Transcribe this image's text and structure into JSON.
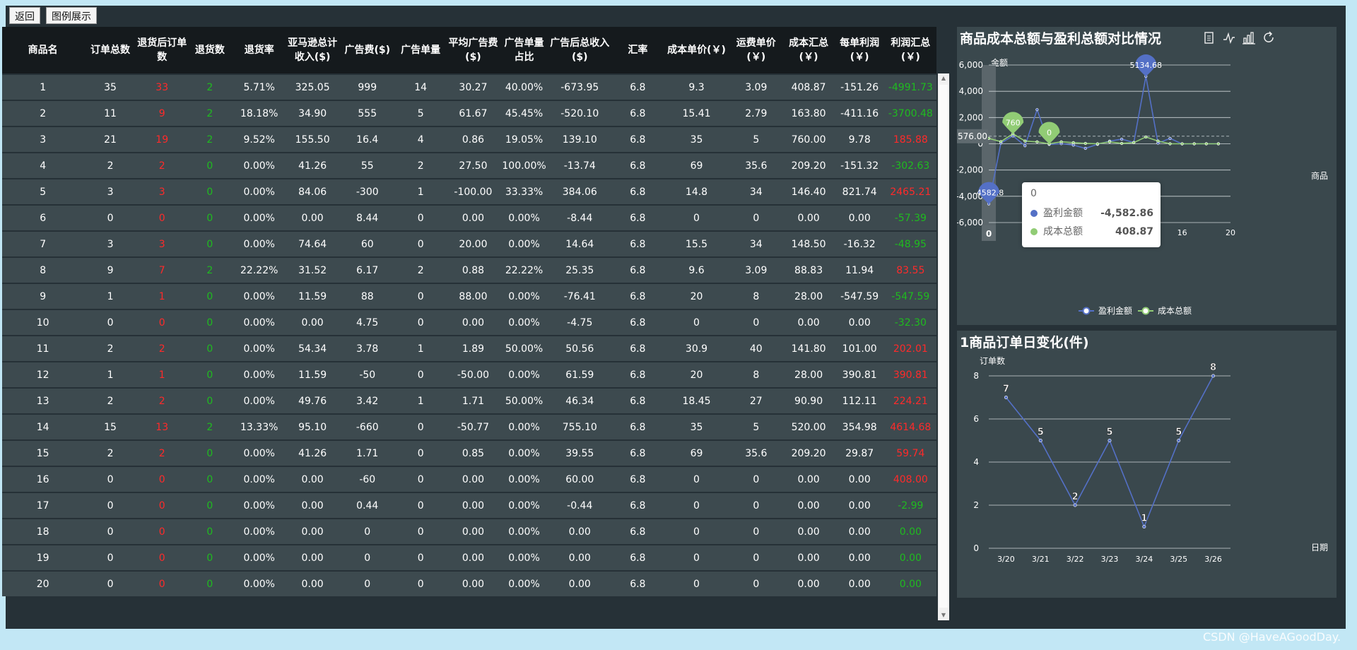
{
  "toolbar": {
    "back_label": "返回",
    "legend_label": "图例展示"
  },
  "table": {
    "headers": [
      "商品名",
      "订单总数",
      "退货后订单数",
      "退货数",
      "退货率",
      "亚马逊总计收入($)",
      "广告费($)",
      "广告单量",
      "平均广告费($)",
      "广告单量占比",
      "广告后总收入($)",
      "汇率",
      "成本单价(￥)",
      "运费单价(￥)",
      "成本汇总(￥)",
      "每单利润(￥)",
      "利润汇总(￥)"
    ],
    "rows": [
      [
        "1",
        "35",
        "33",
        "2",
        "5.71%",
        "325.05",
        "999",
        "14",
        "30.27",
        "40.00%",
        "-673.95",
        "6.8",
        "9.3",
        "3.09",
        "408.87",
        "-151.26",
        "-4991.73"
      ],
      [
        "2",
        "11",
        "9",
        "2",
        "18.18%",
        "34.90",
        "555",
        "5",
        "61.67",
        "45.45%",
        "-520.10",
        "6.8",
        "15.41",
        "2.79",
        "163.80",
        "-411.16",
        "-3700.48"
      ],
      [
        "3",
        "21",
        "19",
        "2",
        "9.52%",
        "155.50",
        "16.4",
        "4",
        "0.86",
        "19.05%",
        "139.10",
        "6.8",
        "35",
        "5",
        "760.00",
        "9.78",
        "185.88"
      ],
      [
        "4",
        "2",
        "2",
        "0",
        "0.00%",
        "41.26",
        "55",
        "2",
        "27.50",
        "100.00%",
        "-13.74",
        "6.8",
        "69",
        "35.6",
        "209.20",
        "-151.32",
        "-302.63"
      ],
      [
        "5",
        "3",
        "3",
        "0",
        "0.00%",
        "84.06",
        "-300",
        "1",
        "-100.00",
        "33.33%",
        "384.06",
        "6.8",
        "14.8",
        "34",
        "146.40",
        "821.74",
        "2465.21"
      ],
      [
        "6",
        "0",
        "0",
        "0",
        "0.00%",
        "0.00",
        "8.44",
        "0",
        "0.00",
        "0.00%",
        "-8.44",
        "6.8",
        "0",
        "0",
        "0.00",
        "0.00",
        "-57.39"
      ],
      [
        "7",
        "3",
        "3",
        "0",
        "0.00%",
        "74.64",
        "60",
        "0",
        "20.00",
        "0.00%",
        "14.64",
        "6.8",
        "15.5",
        "34",
        "148.50",
        "-16.32",
        "-48.95"
      ],
      [
        "8",
        "9",
        "7",
        "2",
        "22.22%",
        "31.52",
        "6.17",
        "2",
        "0.88",
        "22.22%",
        "25.35",
        "6.8",
        "9.6",
        "3.09",
        "88.83",
        "11.94",
        "83.55"
      ],
      [
        "9",
        "1",
        "1",
        "0",
        "0.00%",
        "11.59",
        "88",
        "0",
        "88.00",
        "0.00%",
        "-76.41",
        "6.8",
        "20",
        "8",
        "28.00",
        "-547.59",
        "-547.59"
      ],
      [
        "10",
        "0",
        "0",
        "0",
        "0.00%",
        "0.00",
        "4.75",
        "0",
        "0.00",
        "0.00%",
        "-4.75",
        "6.8",
        "0",
        "0",
        "0.00",
        "0.00",
        "-32.30"
      ],
      [
        "11",
        "2",
        "2",
        "0",
        "0.00%",
        "54.34",
        "3.78",
        "1",
        "1.89",
        "50.00%",
        "50.56",
        "6.8",
        "30.9",
        "40",
        "141.80",
        "101.00",
        "202.01"
      ],
      [
        "12",
        "1",
        "1",
        "0",
        "0.00%",
        "11.59",
        "-50",
        "0",
        "-50.00",
        "0.00%",
        "61.59",
        "6.8",
        "20",
        "8",
        "28.00",
        "390.81",
        "390.81"
      ],
      [
        "13",
        "2",
        "2",
        "0",
        "0.00%",
        "49.76",
        "3.42",
        "1",
        "1.71",
        "50.00%",
        "46.34",
        "6.8",
        "18.45",
        "27",
        "90.90",
        "112.11",
        "224.21"
      ],
      [
        "14",
        "15",
        "13",
        "2",
        "13.33%",
        "95.10",
        "-660",
        "0",
        "-50.77",
        "0.00%",
        "755.10",
        "6.8",
        "35",
        "5",
        "520.00",
        "354.98",
        "4614.68"
      ],
      [
        "15",
        "2",
        "2",
        "0",
        "0.00%",
        "41.26",
        "1.71",
        "0",
        "0.85",
        "0.00%",
        "39.55",
        "6.8",
        "69",
        "35.6",
        "209.20",
        "29.87",
        "59.74"
      ],
      [
        "16",
        "0",
        "0",
        "0",
        "0.00%",
        "0.00",
        "-60",
        "0",
        "0.00",
        "0.00%",
        "60.00",
        "6.8",
        "0",
        "0",
        "0.00",
        "0.00",
        "408.00"
      ],
      [
        "17",
        "0",
        "0",
        "0",
        "0.00%",
        "0.00",
        "0.44",
        "0",
        "0.00",
        "0.00%",
        "-0.44",
        "6.8",
        "0",
        "0",
        "0.00",
        "0.00",
        "-2.99"
      ],
      [
        "18",
        "0",
        "0",
        "0",
        "0.00%",
        "0.00",
        "0",
        "0",
        "0.00",
        "0.00%",
        "0.00",
        "6.8",
        "0",
        "0",
        "0.00",
        "0.00",
        "0.00"
      ],
      [
        "19",
        "0",
        "0",
        "0",
        "0.00%",
        "0.00",
        "0",
        "0",
        "0.00",
        "0.00%",
        "0.00",
        "6.8",
        "0",
        "0",
        "0.00",
        "0.00",
        "0.00"
      ],
      [
        "20",
        "0",
        "0",
        "0",
        "0.00%",
        "0.00",
        "0",
        "0",
        "0.00",
        "0.00%",
        "0.00",
        "6.8",
        "0",
        "0",
        "0.00",
        "0.00",
        "0.00"
      ]
    ]
  },
  "colors": {
    "red": "#ff2a2a",
    "green": "#1fbb1f",
    "profit_series": "#5470c6",
    "cost_series": "#91cc75"
  },
  "chart1": {
    "title": "商品成本总额与盈利总额对比情况",
    "y_name": "金额",
    "x_name": "商品",
    "toolbox_icons": [
      "data-view-icon",
      "line-chart-icon",
      "bar-chart-icon",
      "restore-icon"
    ],
    "pointer_label": "576.00",
    "x_pointer_label": "0",
    "tooltip": {
      "header": "0",
      "rows": [
        {
          "name": "盈利金额",
          "value": "-4,582.86"
        },
        {
          "name": "成本总额",
          "value": "408.87"
        }
      ]
    },
    "legend": [
      "盈利金额",
      "成本总额"
    ]
  },
  "chart2": {
    "title": "1商品订单日变化(件)",
    "y_name": "订单数",
    "x_name": "日期"
  },
  "chart_data": [
    {
      "type": "line",
      "title": "商品成本总额与盈利总额对比情况",
      "xlabel": "商品",
      "ylabel": "金额",
      "x": [
        0,
        1,
        2,
        3,
        4,
        5,
        6,
        7,
        8,
        9,
        10,
        11,
        12,
        13,
        14,
        15,
        16,
        17,
        18,
        19
      ],
      "xticks": [
        0,
        4,
        8,
        12,
        16,
        20
      ],
      "xlim": [
        0,
        20
      ],
      "ylim": [
        -6000,
        6000
      ],
      "yticks": [
        -6000,
        -4000,
        -2000,
        0,
        2000,
        4000,
        6000
      ],
      "ytick_labels": [
        "-6,000",
        "-4,000",
        "-2,000",
        "0",
        "2,000",
        "4,000",
        "6,000"
      ],
      "series": [
        {
          "name": "盈利金额",
          "values": [
            -4582.8,
            50,
            600,
            -150,
            2600,
            -50,
            10,
            -100,
            -350,
            -40,
            200,
            350,
            100,
            5134.68,
            50,
            410,
            -10,
            0,
            0,
            0
          ]
        },
        {
          "name": "成本总额",
          "values": [
            408.87,
            163.8,
            760,
            209.2,
            146.4,
            0,
            148.5,
            88.83,
            28,
            0,
            141.8,
            28,
            90.9,
            520,
            209.2,
            0,
            0,
            0,
            0,
            0
          ]
        }
      ],
      "point_labels": [
        {
          "series": "盈利金额",
          "x": 0,
          "text": "-4582.8"
        },
        {
          "series": "盈利金额",
          "x": 13,
          "text": "5134.68"
        },
        {
          "series": "成本总额",
          "x": 2,
          "text": "760"
        },
        {
          "series": "成本总额",
          "x": 5,
          "text": "0"
        }
      ],
      "mark_line_value": 576,
      "legend_position": "bottom",
      "grid": true
    },
    {
      "type": "line",
      "title": "1商品订单日变化(件)",
      "xlabel": "日期",
      "ylabel": "订单数",
      "categories": [
        "3/20",
        "3/21",
        "3/22",
        "3/23",
        "3/24",
        "3/25",
        "3/26"
      ],
      "values": [
        7,
        5,
        2,
        5,
        1,
        5,
        8
      ],
      "ylim": [
        0,
        8
      ],
      "yticks": [
        0,
        2,
        4,
        6,
        8
      ],
      "grid": true
    }
  ],
  "watermark": "CSDN @HaveAGoodDay."
}
